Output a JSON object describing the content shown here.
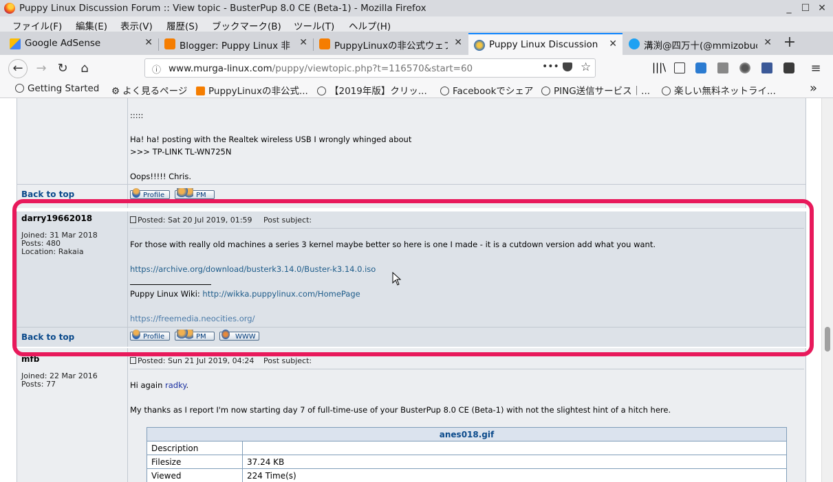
{
  "window": {
    "title": "Puppy Linux Discussion Forum :: View topic - BusterPup 8.0 CE (Beta-1) - Mozilla Firefox"
  },
  "menu": [
    "ファイル(F)",
    "編集(E)",
    "表示(V)",
    "履歴(S)",
    "ブックマーク(B)",
    "ツール(T)",
    "ヘルプ(H)"
  ],
  "tabs": [
    {
      "label": "Google AdSense",
      "icon": "adsense-icon"
    },
    {
      "label": "Blogger: Puppy Linux 非",
      "icon": "blogger-icon"
    },
    {
      "label": "PuppyLinuxの非公式ウェブ",
      "icon": "blogger-icon"
    },
    {
      "label": "Puppy Linux Discussion",
      "icon": "puppy-icon",
      "active": true
    },
    {
      "label": "溝渕@四万十(@mmizobuch",
      "icon": "twitter-icon"
    }
  ],
  "url": {
    "domain": "www.murga-linux.com",
    "path": "/puppy/viewtopic.php?t=116570&start=60"
  },
  "bookmarks": [
    "Getting Started",
    "よく見るページ",
    "PuppyLinuxの非公式...",
    "【2019年版】クリッ...",
    "Facebookでシェア",
    "PING送信サービス｜...",
    "楽しい無料ネットライ..."
  ],
  "posts": {
    "prev": {
      "lines": [
        ":::::",
        "Ha! ha! posting with the Realtek wireless USB I wrongly whinged about",
        ">>> TP-LINK TL-WN725N",
        "Oops!!!!! Chris."
      ],
      "back_to_top": "Back to top",
      "btn_profile": "Profile",
      "btn_pm": "PM"
    },
    "main": {
      "author": "darry19662018",
      "joined": "Joined: 31 Mar 2018",
      "posts": "Posts: 480",
      "location": "Location: Rakaia",
      "posted": "Posted: Sat 20 Jul 2019, 01:59",
      "subject": "Post subject:",
      "body": "For those with really old machines a series 3 kernel maybe better so here is one I made - it is a cutdown version add what you want.",
      "link1": "https://archive.org/download/busterk3.14.0/Buster-k3.14.0.iso",
      "sig_label": "Puppy Linux Wiki: ",
      "sig_link": "http://wikka.puppylinux.com/HomePage",
      "link2": "https://freemedia.neocities.org/",
      "back_to_top": "Back to top",
      "btn_profile": "Profile",
      "btn_pm": "PM",
      "btn_www": "WWW"
    },
    "next": {
      "author": "mfb",
      "joined": "Joined: 22 Mar 2016",
      "posts": "Posts: 77",
      "posted": "Posted: Sun 21 Jul 2019, 04:24",
      "subject": "Post subject:",
      "greeting_pre": "Hi again ",
      "greeting_name": "radky",
      "body": "My thanks as I report I'm now starting day 7 of full-time-use of your BusterPup 8.0 CE (Beta-1) with not the slightest hint of a hitch here.",
      "attachment": {
        "filename": "anes018.gif",
        "rows": [
          [
            "Description",
            ""
          ],
          [
            "Filesize",
            "37.24 KB"
          ],
          [
            "Viewed",
            "224 Time(s)"
          ]
        ]
      }
    }
  }
}
